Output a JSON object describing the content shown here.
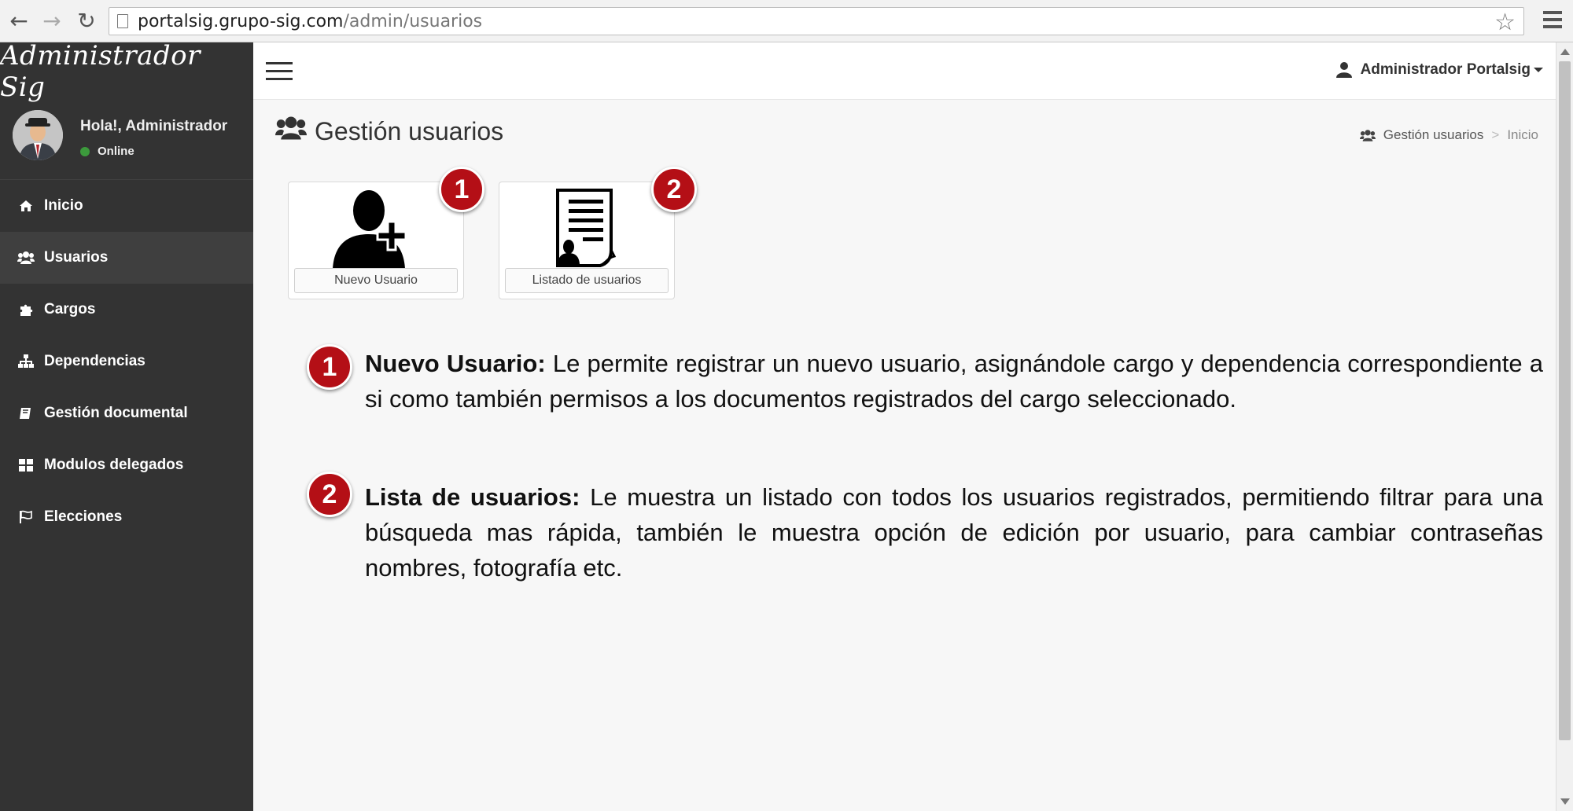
{
  "browser": {
    "url_host": "portalsig.grupo-sig.com",
    "url_path": "/admin/usuarios"
  },
  "sidebar": {
    "brand": "Administrador Sig",
    "greeting": "Hola!, Administrador",
    "status": "Online",
    "status_color": "#3c9a3c",
    "items": [
      {
        "label": "Inicio",
        "icon": "home-icon"
      },
      {
        "label": "Usuarios",
        "icon": "users-icon",
        "active": true
      },
      {
        "label": "Cargos",
        "icon": "puzzle-icon"
      },
      {
        "label": "Dependencias",
        "icon": "sitemap-icon"
      },
      {
        "label": "Gestión documental",
        "icon": "book-icon"
      },
      {
        "label": "Modulos delegados",
        "icon": "grid-icon"
      },
      {
        "label": "Elecciones",
        "icon": "flag-icon"
      }
    ]
  },
  "header": {
    "account": "Administrador Portalsig"
  },
  "page": {
    "title": "Gestión usuarios",
    "breadcrumb": [
      "Gestión usuarios",
      ">",
      "Inicio"
    ]
  },
  "tiles": [
    {
      "label": "Nuevo Usuario",
      "badge": "1",
      "icon": "add-user-icon"
    },
    {
      "label": "Listado de usuarios",
      "badge": "2",
      "icon": "user-list-icon"
    }
  ],
  "descriptions": [
    {
      "badge": "1",
      "title": "Nuevo Usuario:",
      "text": " Le permite registrar un nuevo usuario, asignándole cargo y dependencia correspondiente a si como también permisos a los documentos registrados del cargo seleccionado."
    },
    {
      "badge": "2",
      "title": "Lista de usuarios:",
      "text": " Le muestra un listado con todos los usuarios registrados, permitiendo filtrar para una búsqueda mas rápida, también le muestra opción de edición por usuario, para cambiar contraseñas nombres, fotografía etc."
    }
  ],
  "colors": {
    "sidebar_bg": "#333333",
    "badge_red": "#b40f16"
  }
}
